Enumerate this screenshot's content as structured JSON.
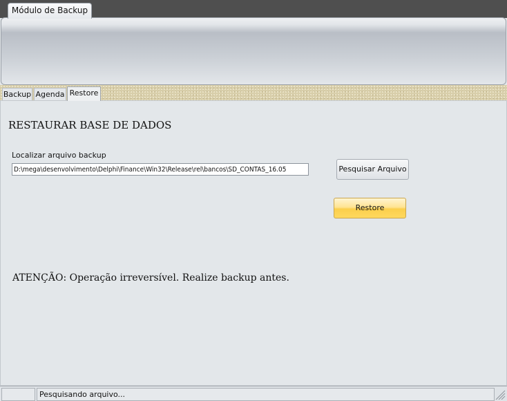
{
  "ribbon": {
    "tab_label": "Módulo de Backup"
  },
  "tabs": [
    {
      "label": "Backup"
    },
    {
      "label": "Agenda"
    },
    {
      "label": "Restore",
      "active": true
    }
  ],
  "restore": {
    "heading": "RESTAURAR BASE DE DADOS",
    "field_label": "Localizar arquivo backup",
    "path_value": "D:\\mega\\desenvolvimento\\Delphi\\Finance\\Win32\\Release\\rel\\bancos\\SD_CONTAS_16.05",
    "search_button": "Pesquisar Arquivo",
    "restore_button": "Restore",
    "warning": "ATENÇÃO: Operação irreversível. Realize backup antes."
  },
  "status": {
    "panel1": "",
    "panel2": "Pesquisando arquivo..."
  }
}
